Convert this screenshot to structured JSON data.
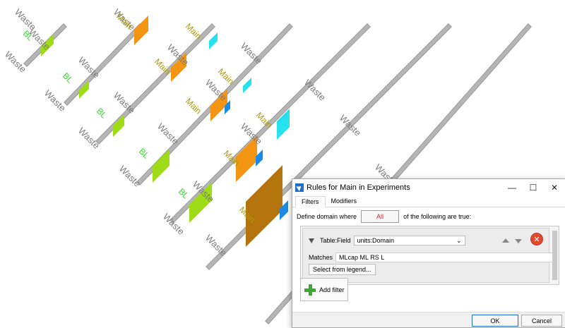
{
  "canvas": {
    "waste_label": "Waste",
    "bl_label": "BL",
    "main_label": "Main",
    "colors": {
      "pipe": "#b5b5b5",
      "waste_text": "#7d7d7d",
      "bl_green": "#35e02a",
      "bl_lime": "#9edc18",
      "main_orange": "#f39512",
      "main_brown": "#b4740d",
      "main_text": "#b09a08",
      "cyan": "#26e2ef",
      "blue": "#1c8be6"
    }
  },
  "dialog": {
    "title": "Rules for Main in Experiments",
    "tabs": [
      "Filters",
      "Modifiers"
    ],
    "define_prefix": "Define domain where",
    "all_value": "All",
    "define_suffix": "of the following are true:",
    "table_field_label": "Table:Field",
    "field_value": "units:Domain",
    "matches_label": "Matches",
    "matches_value": "MLcap ML RS L",
    "legend_button": "Select from legend...",
    "add_filter": "Add filter",
    "ok": "OK",
    "cancel": "Cancel"
  }
}
